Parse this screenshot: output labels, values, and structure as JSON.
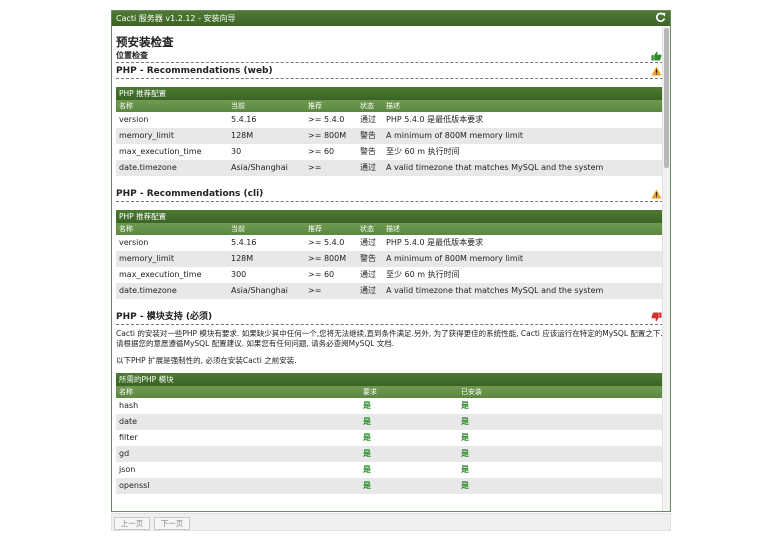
{
  "window": {
    "title": "Cacti 服务器 v1.2.12 - 安装向导"
  },
  "page": {
    "title": "预安装检查",
    "location_check": "位置检查"
  },
  "colors": {
    "header_green": "#3c6426",
    "subheader_green": "#5b8740",
    "ok_green": "#2f8a2f",
    "warn_orange": "#f0a020",
    "error_red": "#d32f2f"
  },
  "sections": {
    "web": {
      "title": "PHP - Recommendations (web)",
      "status_icon": "warning-icon",
      "panel_title": "PHP 推荐配置",
      "columns": [
        "名称",
        "当前",
        "推荐",
        "状态",
        "描述"
      ],
      "rows": [
        [
          "version",
          "5.4.16",
          ">= 5.4.0",
          "通过",
          "PHP 5.4.0 是最低版本要求"
        ],
        [
          "memory_limit",
          "128M",
          ">= 800M",
          "警告",
          "A minimum of 800M memory limit"
        ],
        [
          "max_execution_time",
          "30",
          ">= 60",
          "警告",
          "至少 60 m 执行时间"
        ],
        [
          "date.timezone",
          "Asia/Shanghai",
          ">=",
          "通过",
          "A valid timezone that matches MySQL and the system"
        ]
      ]
    },
    "cli": {
      "title": "PHP - Recommendations (cli)",
      "status_icon": "warning-icon",
      "panel_title": "PHP 推荐配置",
      "columns": [
        "名称",
        "当前",
        "推荐",
        "状态",
        "描述"
      ],
      "rows": [
        [
          "version",
          "5.4.16",
          ">= 5.4.0",
          "通过",
          "PHP 5.4.0 是最低版本要求"
        ],
        [
          "memory_limit",
          "128M",
          ">= 800M",
          "警告",
          "A minimum of 800M memory limit"
        ],
        [
          "max_execution_time",
          "300",
          ">= 60",
          "通过",
          "至少 60 m 执行时间"
        ],
        [
          "date.timezone",
          "Asia/Shanghai",
          ">=",
          "通过",
          "A valid timezone that matches MySQL and the system"
        ]
      ]
    },
    "modules": {
      "title": "PHP - 模块支持 (必须)",
      "status_icon": "thumbs-down-icon",
      "description": "Cacti 的安装对一些PHP 模块有要求. 如果缺少其中任何一个,您将无法继续,直到条件满足.另外, 为了获得更佳的系统性能, Cacti 应该运行在特定的MySQL 配置之下. 请根据您的意愿遵循MySQL 配置建议. 如果您有任何问题, 请务必查阅MySQL 文档.",
      "note": "以下PHP 扩展是强制性的, 必须在安装Cacti 之前安装.",
      "panel_title": "所需的PHP 模块",
      "columns": [
        "名称",
        "要求",
        "已安装"
      ],
      "rows": [
        [
          "hash",
          "是",
          "是"
        ],
        [
          "date",
          "是",
          "是"
        ],
        [
          "filter",
          "是",
          "是"
        ],
        [
          "gd",
          "是",
          "是"
        ],
        [
          "json",
          "是",
          "是"
        ],
        [
          "openssl",
          "是",
          "是"
        ]
      ]
    }
  },
  "footer": {
    "prev_label": "上一页",
    "next_label": "下一页"
  }
}
